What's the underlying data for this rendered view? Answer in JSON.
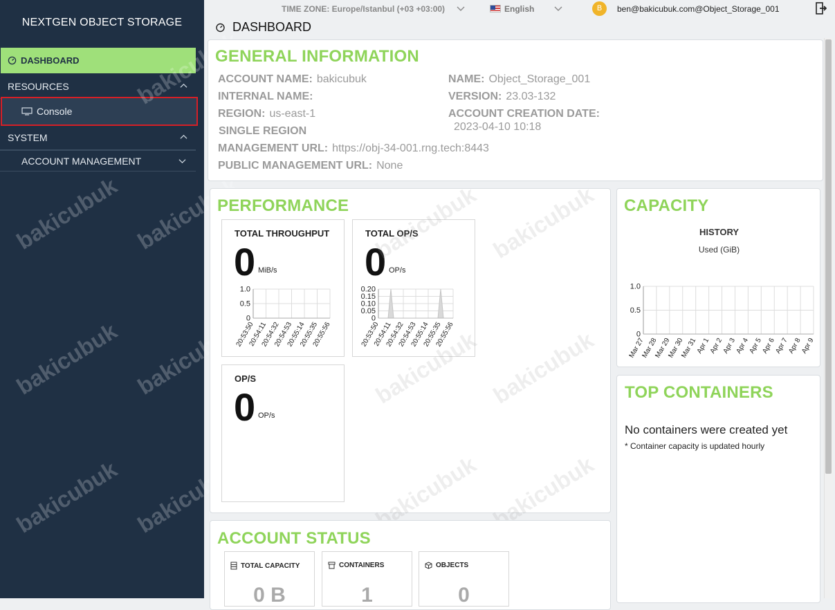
{
  "sidebar": {
    "brand": "NEXTGEN OBJECT STORAGE",
    "dashboard": "DASHBOARD",
    "resources": "RESOURCES",
    "console": "Console",
    "system": "SYSTEM",
    "account_management": "ACCOUNT MANAGEMENT"
  },
  "topbar": {
    "timezone": "TIME ZONE: Europe/Istanbul (+03 +03:00)",
    "language": "English",
    "avatar_letter": "B",
    "user": "ben@bakicubuk.com@Object_Storage_001"
  },
  "page": {
    "title": "DASHBOARD"
  },
  "general": {
    "title": "GENERAL INFORMATION",
    "account_name_label": "ACCOUNT NAME:",
    "account_name": "bakicubuk",
    "internal_name_label": "INTERNAL NAME:",
    "region_label": "REGION:",
    "region": "us-east-1",
    "single_region": "SINGLE REGION",
    "mgmt_url_label": "MANAGEMENT URL:",
    "mgmt_url": "https://obj-34-001.rng.tech:8443",
    "public_mgmt_url_label": "PUBLIC MANAGEMENT URL:",
    "public_mgmt_url": "None",
    "name_label": "NAME:",
    "name": "Object_Storage_001",
    "version_label": "VERSION:",
    "version": "23.03-132",
    "creation_label": "ACCOUNT CREATION DATE:",
    "creation": "2023-04-10 10:18"
  },
  "performance": {
    "title": "PERFORMANCE",
    "throughput_title": "TOTAL THROUGHPUT",
    "throughput_value": "0",
    "throughput_unit": "MiB/s",
    "ops_title": "TOTAL OP/S",
    "ops_value": "0",
    "ops_unit": "OP/s",
    "op_title": "OP/S",
    "op_value": "0",
    "op_unit": "OP/s"
  },
  "capacity": {
    "title": "CAPACITY",
    "history": "HISTORY",
    "used": "Used (GiB)"
  },
  "top_containers": {
    "title": "TOP CONTAINERS",
    "empty": "No containers were created yet",
    "note": "* Container capacity is updated hourly"
  },
  "account_status": {
    "title": "ACCOUNT STATUS",
    "total_capacity": "TOTAL CAPACITY",
    "total_capacity_value": "0 B",
    "containers": "CONTAINERS",
    "containers_value": "1",
    "objects": "OBJECTS",
    "objects_value": "0"
  },
  "watermark": "bakicubuk",
  "chart_data": [
    {
      "type": "line",
      "title": "TOTAL THROUGHPUT",
      "x": [
        "20:53:50",
        "20:54:11",
        "20:54:32",
        "20:54:53",
        "20:55:14",
        "20:55:35",
        "20:55:56"
      ],
      "y_ticks": [
        "1.0",
        "0.5",
        "0"
      ],
      "ylim": [
        0,
        1.0
      ],
      "series": [
        {
          "values": [
            0,
            0,
            0,
            0,
            0,
            0,
            0
          ]
        }
      ]
    },
    {
      "type": "area",
      "title": "TOTAL OP/S",
      "x": [
        "20:53:50",
        "20:54:11",
        "20:54:32",
        "20:54:53",
        "20:55:14",
        "20:55:35",
        "20:55:56"
      ],
      "y_ticks": [
        "0.20",
        "0.15",
        "0.10",
        "0.05",
        "0"
      ],
      "ylim": [
        0,
        0.2
      ],
      "series": [
        {
          "values": [
            0,
            0.2,
            0,
            0,
            0,
            0.2,
            0
          ]
        }
      ]
    },
    {
      "type": "line",
      "title": "HISTORY",
      "ylabel": "Used (GiB)",
      "x": [
        "Mar 27",
        "Mar 28",
        "Mar 29",
        "Mar 30",
        "Mar 31",
        "Apr 1",
        "Apr 2",
        "Apr 3",
        "Apr 4",
        "Apr 5",
        "Apr 6",
        "Apr 7",
        "Apr 8",
        "Apr 9"
      ],
      "y_ticks": [
        "1.0",
        "0.5",
        "0"
      ],
      "ylim": [
        0,
        1.0
      ],
      "series": [
        {
          "values": [
            0,
            0,
            0,
            0,
            0,
            0,
            0,
            0,
            0,
            0,
            0,
            0,
            0,
            0
          ]
        }
      ]
    }
  ],
  "colors": {
    "accent_green": "#8fd45a",
    "sidebar_bg": "#1f3044",
    "highlight": "#d61f26"
  }
}
